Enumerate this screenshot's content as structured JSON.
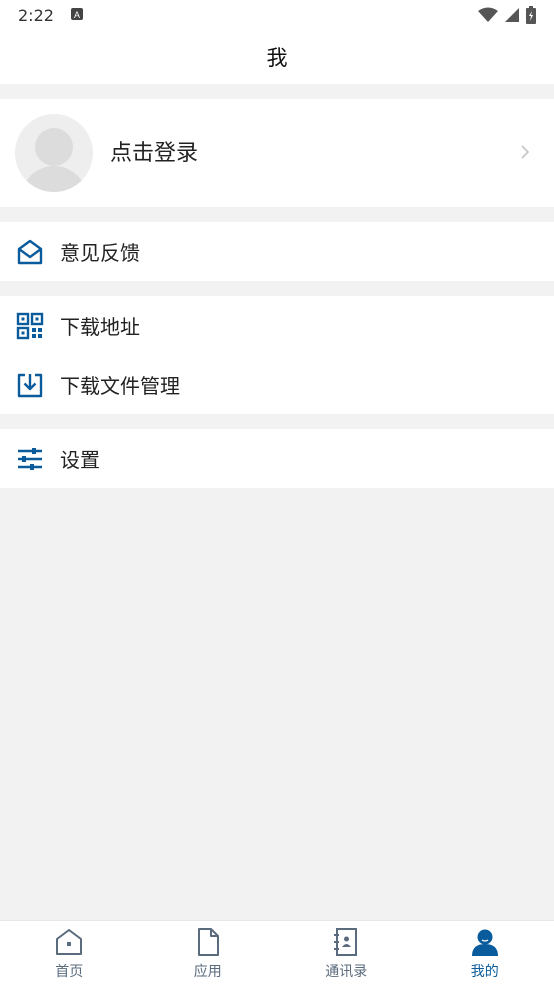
{
  "status": {
    "time": "2:22"
  },
  "appbar": {
    "title": "我"
  },
  "profile": {
    "login_label": "点击登录"
  },
  "menu": {
    "feedback": "意见反馈",
    "download_address": "下载地址",
    "download_files": "下载文件管理",
    "settings": "设置"
  },
  "tabs": [
    {
      "label": "首页",
      "icon": "home-icon"
    },
    {
      "label": "应用",
      "icon": "document-icon"
    },
    {
      "label": "通讯录",
      "icon": "contacts-icon"
    },
    {
      "label": "我的",
      "icon": "user-icon"
    }
  ],
  "colors": {
    "accent": "#0a5b9c",
    "inactive": "#5a6b7d",
    "background": "#f2f2f2"
  }
}
